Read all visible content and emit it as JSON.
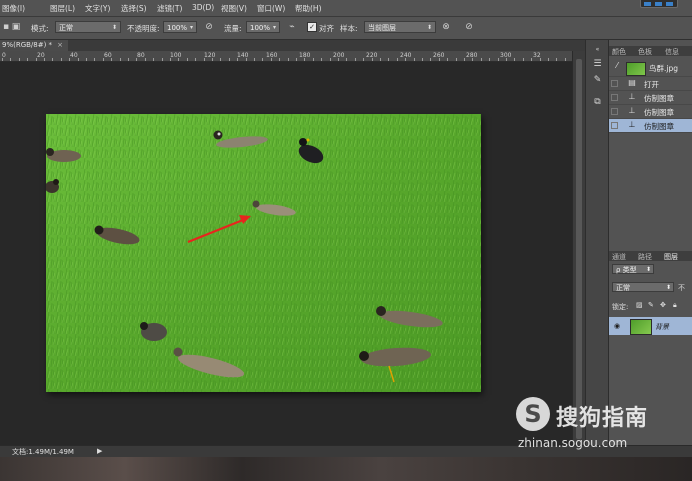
{
  "menu": {
    "items": [
      "图像(I)",
      "图层(L)",
      "文字(Y)",
      "选择(S)",
      "滤镜(T)",
      "3D(D)",
      "视图(V)",
      "窗口(W)",
      "帮助(H)"
    ]
  },
  "options": {
    "mode_label": "模式:",
    "mode_value": "正常",
    "opacity_label": "不透明度:",
    "opacity_value": "100%",
    "flow_label": "流量:",
    "flow_value": "100%",
    "align_label": "对齐",
    "sample_label": "样本:",
    "sample_value": "当前图层"
  },
  "document": {
    "tab_label": "9%(RGB/8#) *",
    "tab_close": "×"
  },
  "ruler": {
    "ticks": [
      "0",
      "20",
      "40",
      "60",
      "80",
      "100",
      "120",
      "140",
      "160",
      "180",
      "200",
      "220",
      "240",
      "260",
      "280",
      "300",
      "32"
    ]
  },
  "history_panel": {
    "tabs": [
      "颜色",
      "色板",
      "信息"
    ],
    "snapshot_name": "鸟群.jpg",
    "items": [
      {
        "label": "打开",
        "icon": "document-icon"
      },
      {
        "label": "仿制图章",
        "icon": "stamp-icon"
      },
      {
        "label": "仿制图章",
        "icon": "stamp-icon"
      },
      {
        "label": "仿制图章",
        "icon": "stamp-icon"
      }
    ]
  },
  "layers_panel": {
    "tabs": [
      "通道",
      "路径",
      "图层"
    ],
    "filter_label": "ρ 类型",
    "blend_value": "正常",
    "opacity_short": "不",
    "lock_label": "锁定:",
    "layer_name": "背景"
  },
  "status": {
    "doc_info": "文档:1.49M/1.49M",
    "arrow": "▶"
  },
  "watermark": {
    "logo_glyph": "S",
    "brand": "搜狗指南",
    "url": "zhinan.sogou.com"
  },
  "colors": {
    "annotation_arrow": "#e8251d",
    "grass": "#5fae32",
    "selection": "#9fb6d6"
  }
}
